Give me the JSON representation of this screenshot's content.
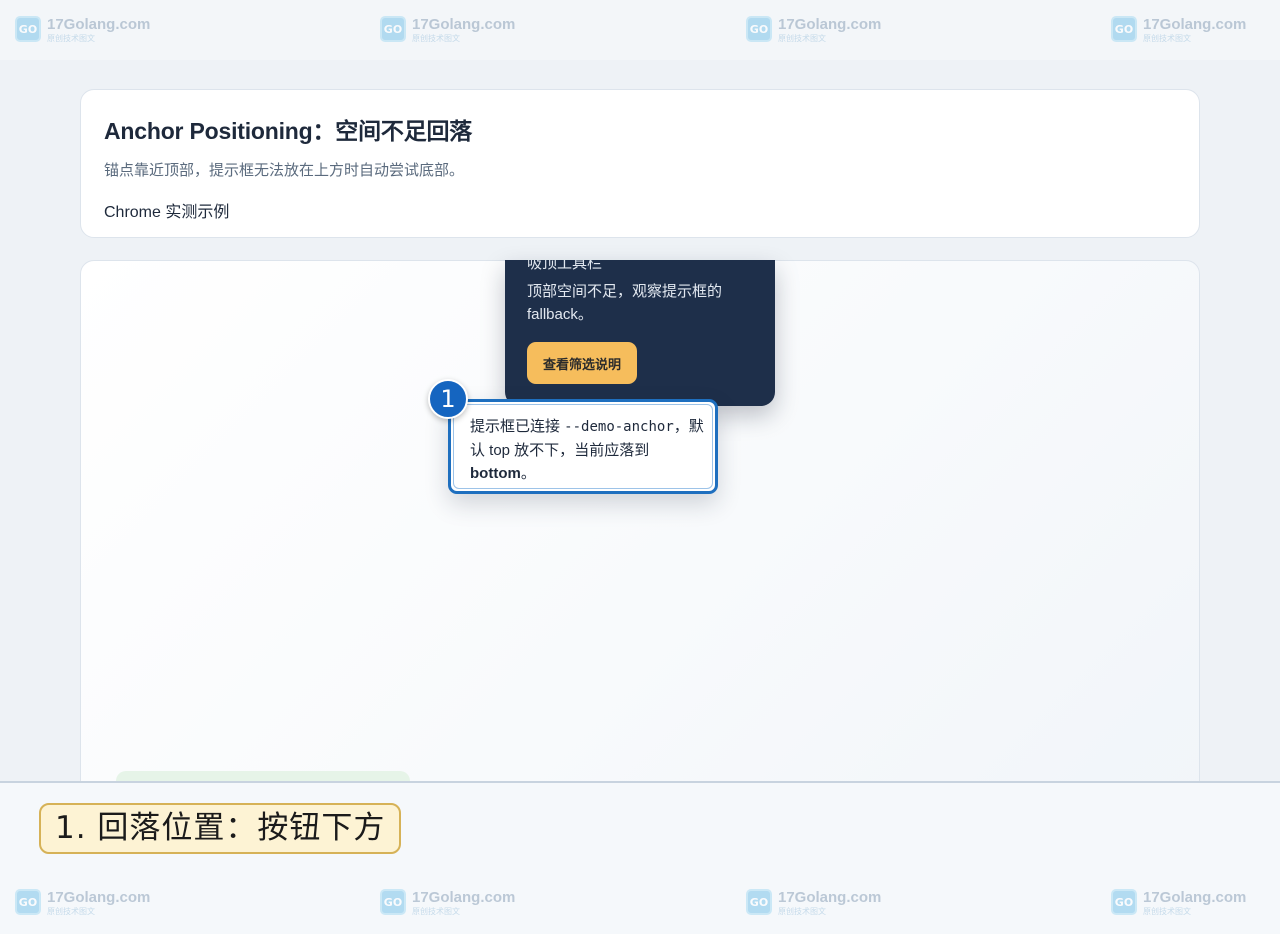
{
  "watermark": {
    "site": "17Golang.com",
    "subtitle": "原创技术图文",
    "logo_icon": "logo-icon"
  },
  "header": {
    "title": "Anchor Positioning：空间不足回落",
    "description": "锚点靠近顶部，提示框无法放在上方时自动尝试底部。",
    "note": "Chrome 实测示例"
  },
  "panel": {
    "cut_title": "吸顶工具栏",
    "text": "顶部空间不足，观察提示框的 fallback。",
    "button_label": "查看筛选说明"
  },
  "tooltip": {
    "text_before": "提示框已连接 ",
    "code": "--demo-anchor",
    "text_middle": "，默认 top 放不下，当前应落到 ",
    "bold": "bottom",
    "text_after": "。"
  },
  "step_badge": "1",
  "caption": "1. 回落位置：按钮下方",
  "colors": {
    "panel_bg": "#1e2f4a",
    "button_bg": "#f6bd5c",
    "tooltip_border": "#1e6fbf",
    "badge_bg": "#1565c0",
    "caption_bg": "#fdf3d4"
  }
}
